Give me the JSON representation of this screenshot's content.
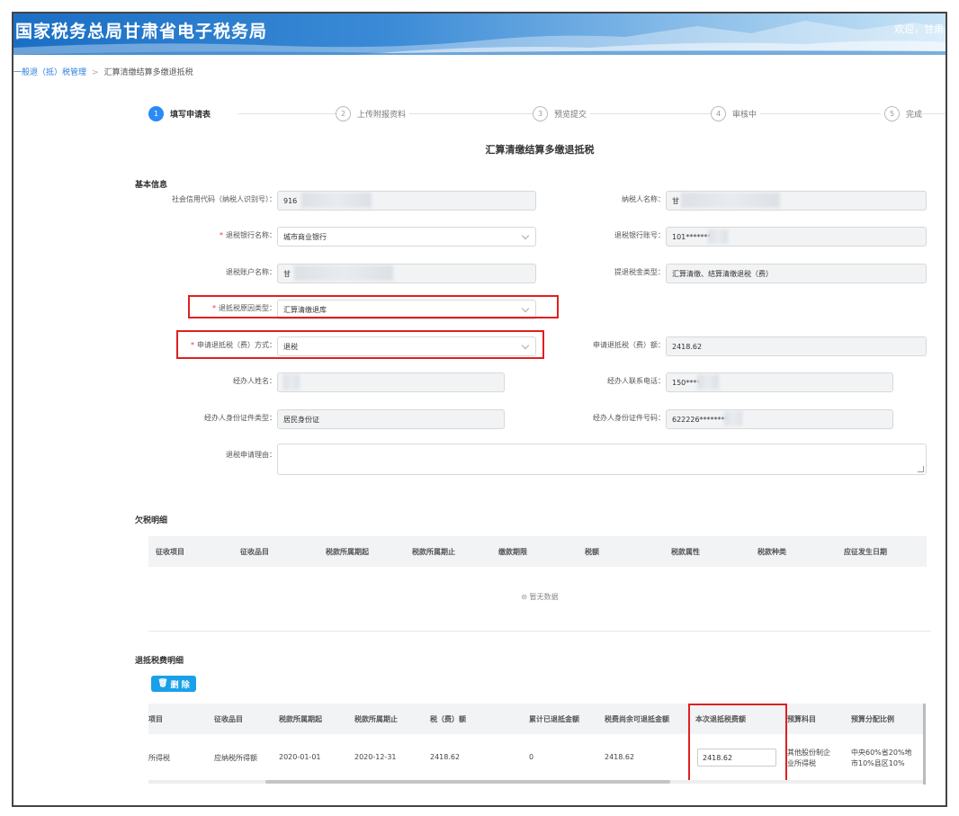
{
  "header": {
    "title": "国家税务总局甘肃省电子税务局",
    "welcome": "欢迎，甘肃"
  },
  "breadcrumb": {
    "home": "一般退（抵）税管理",
    "current": "汇算清缴结算多缴退抵税"
  },
  "steps": [
    {
      "num": "1",
      "label": "填写申请表",
      "active": true
    },
    {
      "num": "2",
      "label": "上传附报资料",
      "active": false
    },
    {
      "num": "3",
      "label": "预览提交",
      "active": false
    },
    {
      "num": "4",
      "label": "审核中",
      "active": false
    },
    {
      "num": "5",
      "label": "完成",
      "active": false
    }
  ],
  "form": {
    "title": "汇算清缴结算多缴退抵税",
    "section_basic": "基本信息",
    "credit_code_label": "社会信用代码（纳税人识别号）：",
    "credit_code_value": "916",
    "taxpayer_name_label": "纳税人名称：",
    "taxpayer_name_value": "甘",
    "bank_name_label": "退税银行名称：",
    "bank_name_value": "城市商业银行",
    "bank_account_label": "退税银行账号：",
    "bank_account_value": "101********",
    "account_name_label": "退税账户名称：",
    "account_name_value": "甘",
    "refund_type_label": "提退税金类型：",
    "refund_type_value": "汇算清缴、结算清缴退税（费）",
    "reason_type_label": "退抵税原因类型：",
    "reason_type_value": "汇算清缴退库",
    "method_label": "申请退抵税（费）方式：",
    "method_value": "退税",
    "amount_label": "申请退抵税（费）额：",
    "amount_value": "2418.62",
    "agent_name_label": "经办人姓名：",
    "agent_name_value": "",
    "agent_phone_label": "经办人联系电话：",
    "agent_phone_value": "150****",
    "agent_id_type_label": "经办人身份证件类型：",
    "agent_id_type_value": "居民身份证",
    "agent_id_no_label": "经办人身份证件号码：",
    "agent_id_no_value": "622226********",
    "reason_label": "退税申请理由："
  },
  "arrears": {
    "title": "欠税明细",
    "columns": [
      "征收项目",
      "征收品目",
      "税款所属期起",
      "税款所属期止",
      "缴款期限",
      "税额",
      "税款属性",
      "税款种类",
      "应征发生日期"
    ],
    "empty_text": "暂无数据"
  },
  "refund_detail": {
    "title": "退抵税费明细",
    "delete_label": "删 除",
    "columns": [
      "项目",
      "征收品目",
      "税款所属期起",
      "税款所属期止",
      "税（费）额",
      "累计已退抵金额",
      "税费尚余可退抵金额",
      "本次退抵税费额",
      "预算科目",
      "预算分配比例"
    ],
    "rows": [
      {
        "item": "所得税",
        "subject": "应纳税所得额",
        "start": "2020-01-01",
        "end": "2020-12-31",
        "tax": "2418.62",
        "refunded": "0",
        "remaining": "2418.62",
        "this_amount": "2418.62",
        "budget_line1": "其他股份制企",
        "budget_line2": "业所得税",
        "ratio_line1": "中央60%省20%地",
        "ratio_line2": "市10%县区10%"
      }
    ]
  }
}
